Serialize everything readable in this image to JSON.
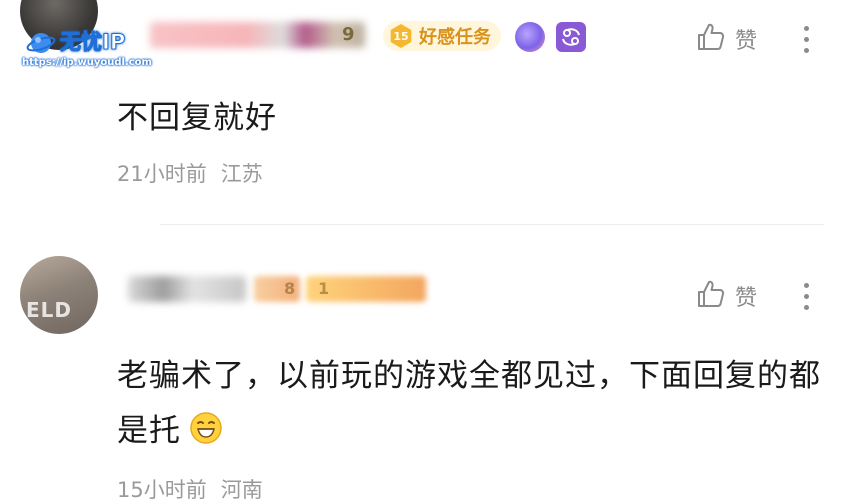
{
  "watermark": {
    "name": "无忧IP",
    "url": "https://ip.wuyoudl.com"
  },
  "comments": [
    {
      "level_badge": "9",
      "task_badge_level": "15",
      "task_badge_label": "好感任务",
      "text": "不回复就好",
      "time": "21小时前",
      "location": "江苏",
      "like_label": "赞"
    },
    {
      "level_badge_a": "8",
      "level_badge_b": "1",
      "text": "老骗术了，以前玩的游戏全都见过，下面回复的都是托",
      "time": "15小时前",
      "location": "河南",
      "like_label": "赞",
      "emoji": "grinning-face-emoji"
    }
  ],
  "colors": {
    "task_badge": "#f5b630",
    "meta_text": "#9a9a9a",
    "icon_gray": "#8a8a8a",
    "watermark_blue": "#1f6fd6"
  }
}
